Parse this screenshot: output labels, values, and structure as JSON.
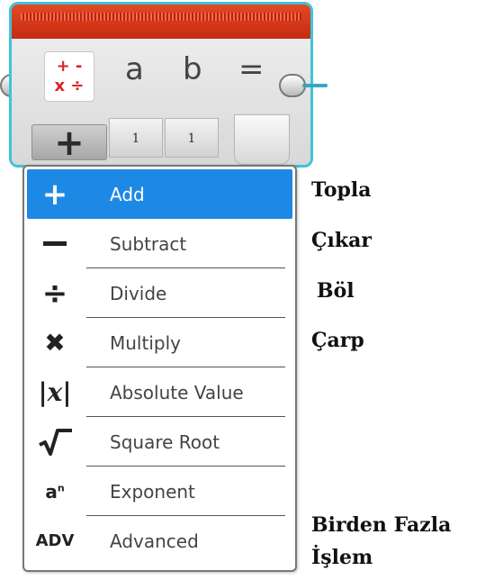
{
  "block": {
    "op_icon_line1": "+ -",
    "op_icon_line2": "x ÷",
    "param_a": "a",
    "param_b": "b",
    "param_result": "=",
    "plus_button": "+",
    "input_a_value": "1",
    "input_b_value": "1",
    "header_color": "#d8381a",
    "border_color": "#3fc3d8"
  },
  "menu": {
    "items": [
      {
        "label": "Add",
        "icon": "plus-icon",
        "glyph": "+"
      },
      {
        "label": "Subtract",
        "icon": "minus-icon",
        "glyph": "—"
      },
      {
        "label": "Divide",
        "icon": "divide-icon",
        "glyph": "÷"
      },
      {
        "label": "Multiply",
        "icon": "multiply-icon",
        "glyph": "✖"
      },
      {
        "label": "Absolute Value",
        "icon": "absolute-value-icon",
        "glyph": "|x|"
      },
      {
        "label": "Square Root",
        "icon": "square-root-icon",
        "glyph": "√‾"
      },
      {
        "label": "Exponent",
        "icon": "exponent-icon",
        "glyph": "aⁿ"
      },
      {
        "label": "Advanced",
        "icon": "advanced-icon",
        "glyph": "ADV"
      }
    ],
    "selected": "Add",
    "selected_color": "#1e88e5"
  },
  "annotations": {
    "add": "Topla",
    "subtract": "Çıkar",
    "divide": "Böl",
    "multiply": "Çarp",
    "advanced_line1": "Birden Fazla",
    "advanced_line2": "İşlem"
  }
}
